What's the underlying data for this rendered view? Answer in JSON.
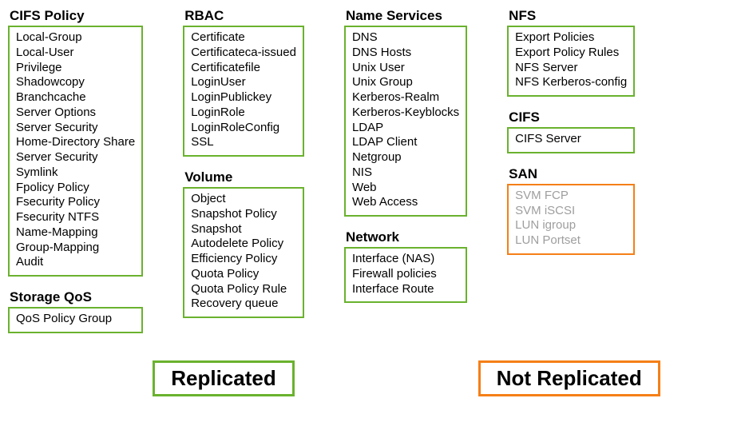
{
  "columns": [
    {
      "groups": [
        {
          "title": "CIFS Policy",
          "color": "green",
          "items": [
            "Local-Group",
            "Local-User",
            "Privilege",
            "Shadowcopy",
            "Branchcache",
            "Server Options",
            "Server Security",
            "Home-Directory Share",
            "Server Security",
            "Symlink",
            "Fpolicy Policy",
            "Fsecurity Policy",
            "Fsecurity NTFS",
            "Name-Mapping",
            "Group-Mapping",
            "Audit"
          ]
        },
        {
          "title": "Storage QoS",
          "color": "green",
          "items": [
            "QoS Policy Group"
          ]
        }
      ]
    },
    {
      "groups": [
        {
          "title": "RBAC",
          "color": "green",
          "items": [
            "Certificate",
            "Certificateca-issued",
            "Certificatefile",
            "LoginUser",
            "LoginPublickey",
            "LoginRole",
            "LoginRoleConfig",
            "SSL"
          ]
        },
        {
          "title": "Volume",
          "color": "green",
          "items": [
            "Object",
            "Snapshot Policy",
            "Snapshot",
            "Autodelete Policy",
            "Efficiency Policy",
            "Quota Policy",
            "Quota Policy Rule",
            "Recovery queue"
          ]
        }
      ]
    },
    {
      "groups": [
        {
          "title": "Name Services",
          "color": "green",
          "items": [
            "DNS",
            "DNS Hosts",
            "Unix User",
            "Unix Group",
            "Kerberos-Realm",
            "Kerberos-Keyblocks",
            "LDAP",
            "LDAP Client",
            "Netgroup",
            "NIS",
            "Web",
            "Web Access"
          ]
        },
        {
          "title": "Network",
          "color": "green",
          "items": [
            "Interface  (NAS)",
            "Firewall policies",
            "Interface  Route"
          ]
        }
      ]
    },
    {
      "groups": [
        {
          "title": "NFS",
          "color": "green",
          "items": [
            "Export Policies",
            "Export Policy Rules",
            "NFS Server",
            "NFS Kerberos-config"
          ]
        },
        {
          "title": "CIFS",
          "color": "green",
          "items": [
            "CIFS Server"
          ]
        },
        {
          "title": "SAN",
          "color": "orange",
          "grey": true,
          "items": [
            "SVM FCP",
            "SVM iSCSI",
            "LUN igroup",
            "LUN Portset"
          ]
        }
      ]
    }
  ],
  "legend": {
    "replicated": "Replicated",
    "not_replicated": "Not Replicated"
  }
}
